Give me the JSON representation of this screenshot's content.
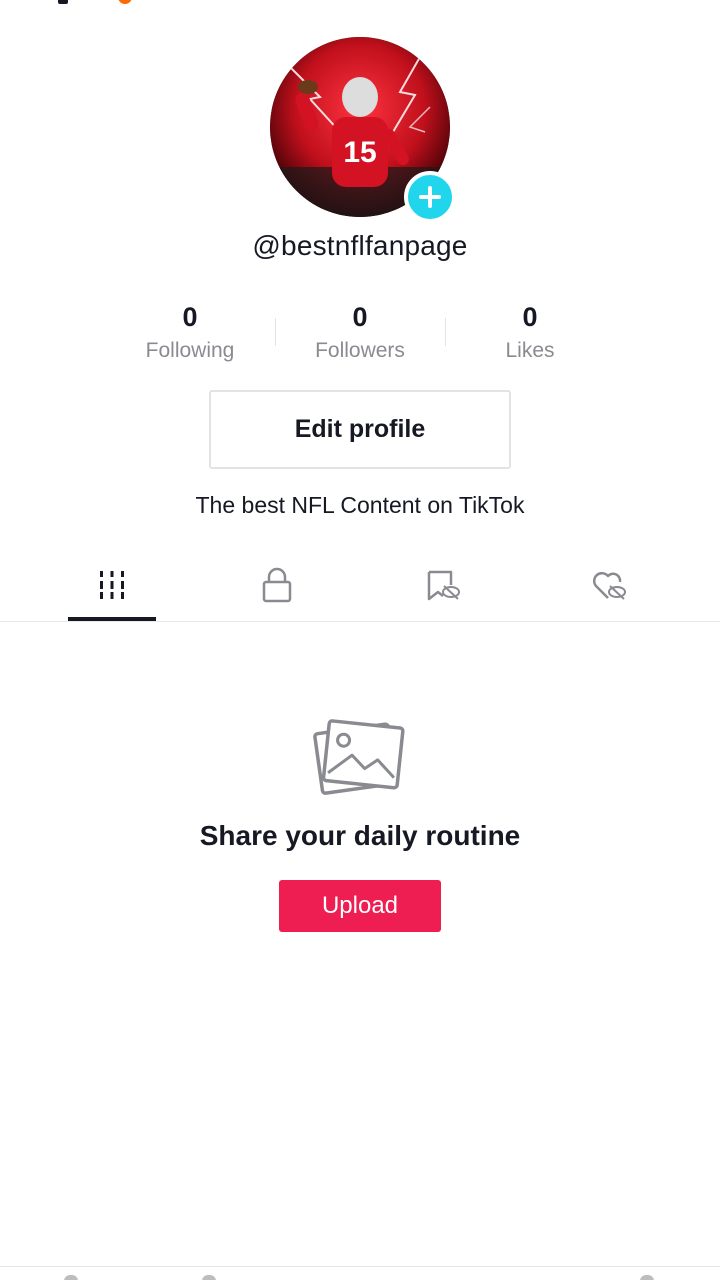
{
  "profile": {
    "username": "@bestnflfanpage",
    "bio": "The best NFL Content on TikTok",
    "avatar_icon": "profile-photo",
    "add_icon": "plus-icon"
  },
  "stats": [
    {
      "value": "0",
      "label": "Following"
    },
    {
      "value": "0",
      "label": "Followers"
    },
    {
      "value": "0",
      "label": "Likes"
    }
  ],
  "edit_profile_label": "Edit profile",
  "tabs": [
    {
      "icon": "videos-grid-icon",
      "selected": true
    },
    {
      "icon": "lock-icon",
      "selected": false
    },
    {
      "icon": "hidden-bookmark-icon",
      "selected": false
    },
    {
      "icon": "hidden-heart-icon",
      "selected": false
    }
  ],
  "empty_state": {
    "icon": "photos-icon",
    "title": "Share your daily routine",
    "button_label": "Upload"
  },
  "colors": {
    "accent": "#ee1d52",
    "add_badge": "#20d5ec",
    "text": "#161823",
    "muted": "#8a8b91"
  }
}
